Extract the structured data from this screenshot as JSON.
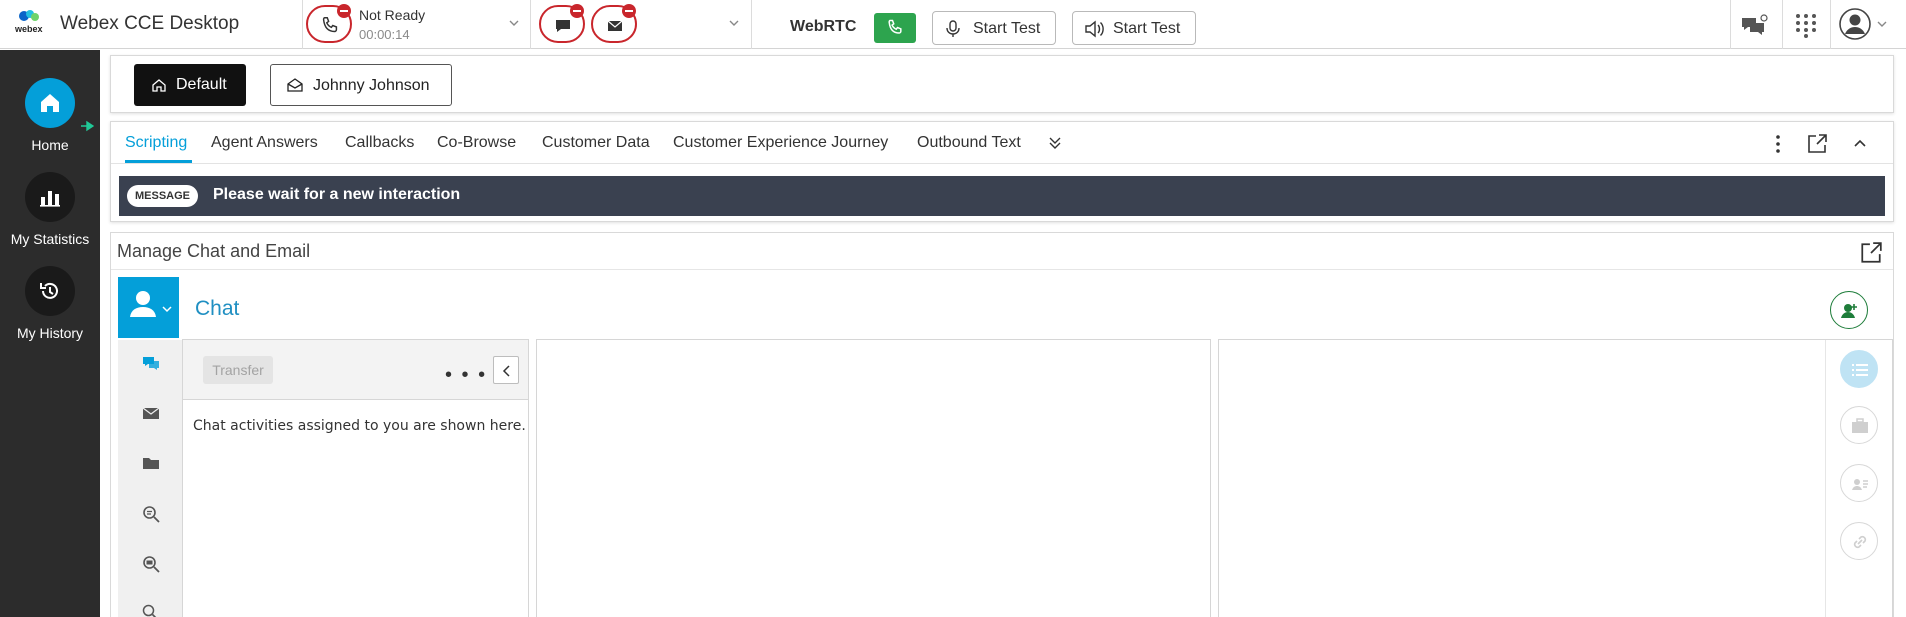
{
  "app": {
    "title": "Webex CCE Desktop",
    "logo_text": "webex"
  },
  "header": {
    "agent_state": "Not Ready",
    "state_timer": "00:00:14",
    "webrtc_label": "WebRTC",
    "mic_test_label": "Start Test",
    "speaker_test_label": "Start Test"
  },
  "nav": {
    "items": [
      {
        "label": "Home",
        "icon": "home-icon",
        "active": true
      },
      {
        "label": "My Statistics",
        "icon": "bar-chart-icon",
        "active": false
      },
      {
        "label": "My History",
        "icon": "history-icon",
        "active": false
      }
    ]
  },
  "layouts": {
    "default_label": "Default",
    "customer_label": "Johnny Johnson"
  },
  "tabs": {
    "items": [
      {
        "label": "Scripting",
        "active": true
      },
      {
        "label": "Agent Answers"
      },
      {
        "label": "Callbacks"
      },
      {
        "label": "Co-Browse"
      },
      {
        "label": "Customer Data"
      },
      {
        "label": "Customer Experience Journey"
      },
      {
        "label": "Outbound Text"
      }
    ]
  },
  "message": {
    "tag": "MESSAGE",
    "text": "Please wait for a new interaction"
  },
  "chat_gadget": {
    "title": "Manage Chat and Email",
    "heading": "Chat",
    "transfer_label": "Transfer",
    "more_label": "• • •",
    "empty_text": "Chat activities assigned to you are shown here."
  },
  "colors": {
    "accent": "#049fd9",
    "not_ready": "#c9262c",
    "call_green": "#2da44e",
    "nav_bg": "#2c2c2c",
    "message_bg": "#3a4150"
  }
}
